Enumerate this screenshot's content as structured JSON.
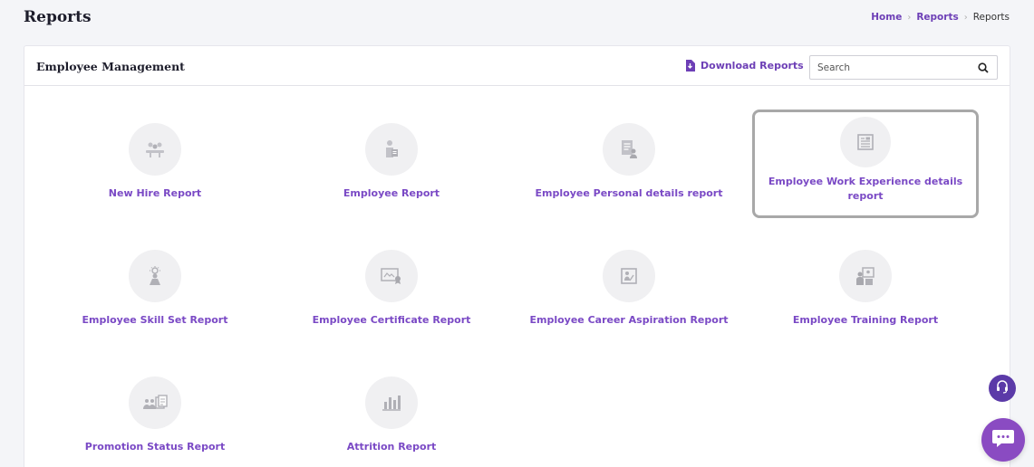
{
  "header": {
    "title": "Reports",
    "breadcrumb": [
      "Home",
      "Reports",
      "Reports"
    ]
  },
  "card": {
    "title": "Employee Management",
    "download_label": "Download Reports",
    "search_placeholder": "Search"
  },
  "reports": [
    {
      "label": "New Hire Report",
      "icon": "new-hire-icon"
    },
    {
      "label": "Employee Report",
      "icon": "employee-icon"
    },
    {
      "label": "Employee Personal details report",
      "icon": "personal-details-icon"
    },
    {
      "label": "Employee Work Experience details report",
      "icon": "work-experience-icon",
      "selected": true
    },
    {
      "label": "Employee Skill Set Report",
      "icon": "skill-set-icon"
    },
    {
      "label": "Employee Certificate Report",
      "icon": "certificate-icon"
    },
    {
      "label": "Employee Career Aspiration Report",
      "icon": "career-aspiration-icon"
    },
    {
      "label": "Employee Training Report",
      "icon": "training-icon"
    },
    {
      "label": "Promotion Status Report",
      "icon": "promotion-status-icon"
    },
    {
      "label": "Attrition Report",
      "icon": "attrition-icon"
    }
  ],
  "colors": {
    "accent": "#7a49c5",
    "accent_dark": "#6d3fb6",
    "icon_bg": "#f0f0f2",
    "support_button": "#5b3aa8",
    "chat_button": "#8a4bc2"
  }
}
